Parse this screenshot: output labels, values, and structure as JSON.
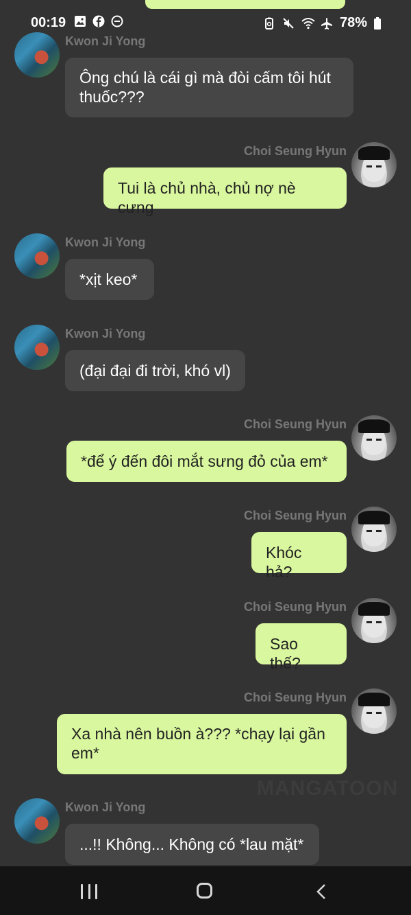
{
  "status_bar": {
    "time": "00:19",
    "left_icons": [
      "gallery-icon",
      "facebook-icon",
      "do-not-disturb-icon"
    ],
    "right_icons": [
      "battery-saver-icon",
      "mute-icon",
      "wifi-icon",
      "airplane-icon"
    ],
    "battery": "78%"
  },
  "messages": [
    {
      "side": "left",
      "sender": "Kwon Ji Yong",
      "text": "Ông chú là cái gì mà đòi cấm tôi hút thuốc???"
    },
    {
      "side": "right",
      "sender": "Choi Seung Hyun",
      "text": "Tui là chủ nhà, chủ nợ nè cưng"
    },
    {
      "side": "left",
      "sender": "Kwon Ji Yong",
      "text": "*xịt keo*"
    },
    {
      "side": "left",
      "sender": "Kwon Ji Yong",
      "text": "(đại đại đi trời, khó vl)"
    },
    {
      "side": "right",
      "sender": "Choi Seung Hyun",
      "text": "*để ý đến đôi mắt sưng đỏ của em*"
    },
    {
      "side": "right",
      "sender": "Choi Seung Hyun",
      "text": "Khóc hả?"
    },
    {
      "side": "right",
      "sender": "Choi Seung Hyun",
      "text": "Sao thế?"
    },
    {
      "side": "right",
      "sender": "Choi Seung Hyun",
      "text": "Xa nhà nên buồn à??? *chạy lại gần em*"
    },
    {
      "side": "left",
      "sender": "Kwon Ji Yong",
      "text": "...!! Không... Không có *lau mặt*"
    }
  ],
  "watermark": "MANGATOON",
  "nav": {
    "recent_icon": "recent-apps-icon",
    "home_icon": "home-icon",
    "back_icon": "back-icon"
  },
  "colors": {
    "background": "#333333",
    "left_bubble": "#464646",
    "right_bubble": "#d9f79e",
    "name_text": "#777777",
    "nav_bar": "#141414"
  }
}
